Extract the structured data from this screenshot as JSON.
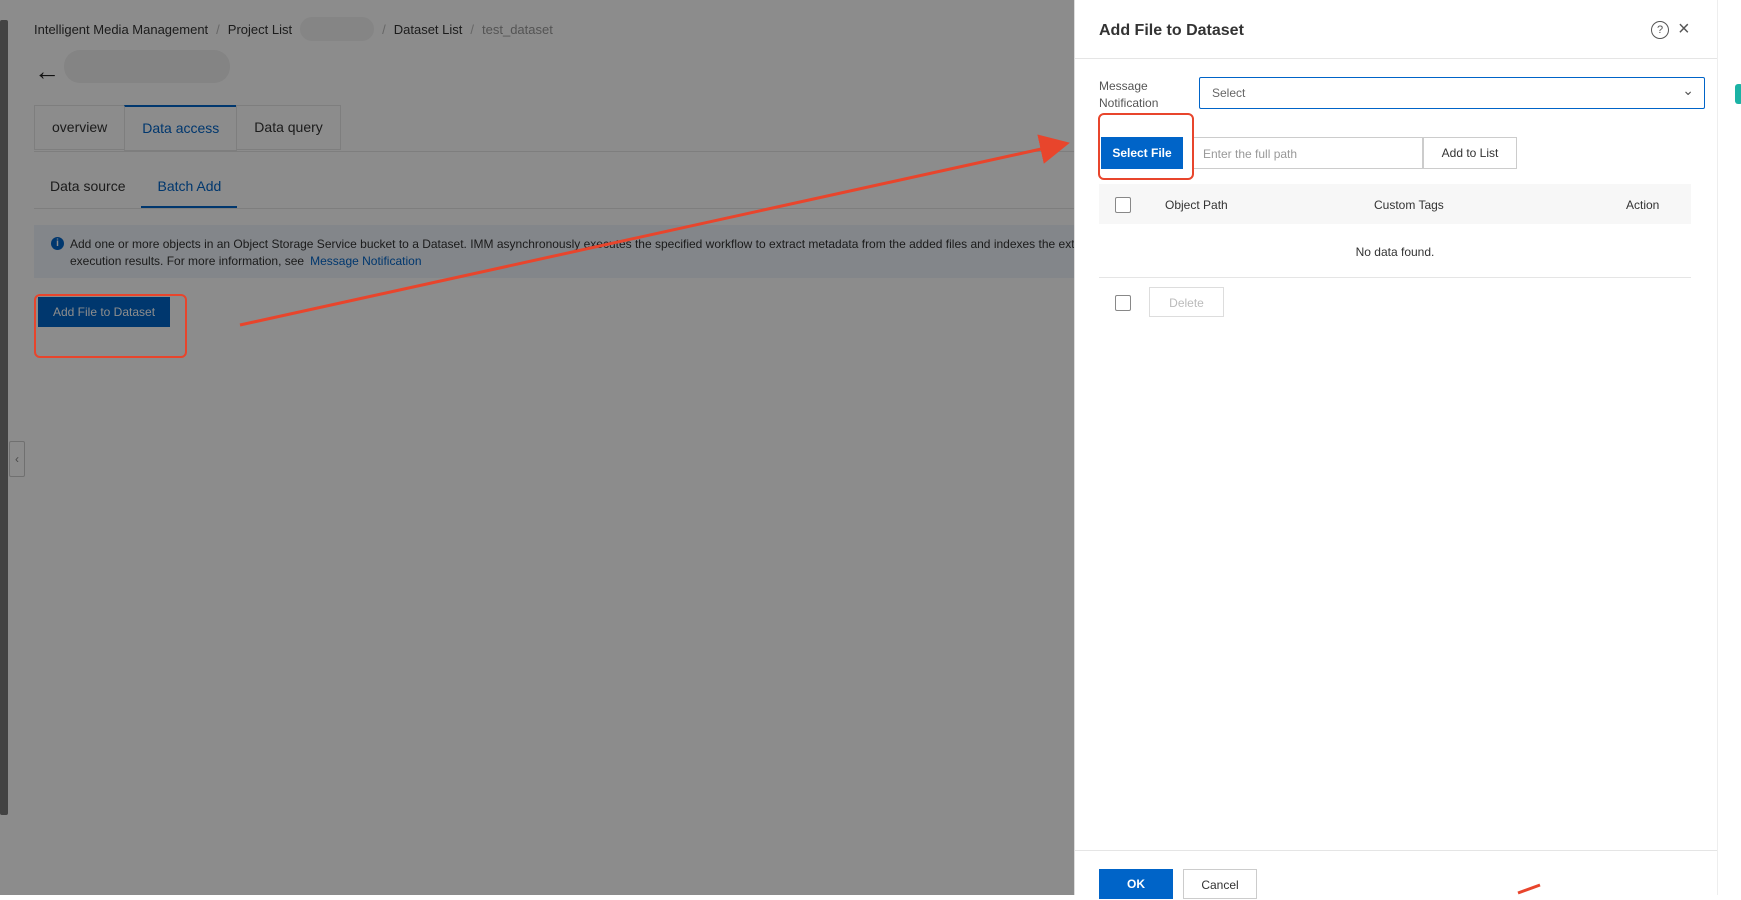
{
  "breadcrumb": {
    "item1": "Intelligent Media Management",
    "item2": "Project List",
    "item4": "Dataset List",
    "item5": "test_dataset",
    "separator": "/"
  },
  "back_icon": "arrow-left-icon",
  "tabs": [
    "overview",
    "Data access",
    "Data query"
  ],
  "subtabs": [
    "Data source",
    "Batch Add"
  ],
  "info": {
    "line1": "Add one or more objects in an Object Storage Service bucket to a Dataset. IMM asynchronously executes the specified workflow to extract metadata from the added files and indexes the extr",
    "line2": "execution results. For more information, see",
    "link": "Message Notification",
    "icon": "i"
  },
  "add_file_button": "Add File to Dataset",
  "drawer": {
    "title": "Add File to Dataset",
    "help_glyph": "?",
    "close_glyph": "×",
    "message_label": "Message Notification",
    "select_placeholder": "Select",
    "select_file_button": "Select File",
    "path_placeholder": "Enter the full path",
    "add_to_list_button": "Add to List",
    "table": {
      "columns": [
        "Object Path",
        "Custom Tags",
        "Action"
      ],
      "empty_text": "No data found."
    },
    "delete_button": "Delete",
    "ok_button": "OK",
    "cancel_button": "Cancel"
  },
  "collapse_glyph": "‹",
  "annotation_color": "#e8452c",
  "accent_color": "#0064c8"
}
